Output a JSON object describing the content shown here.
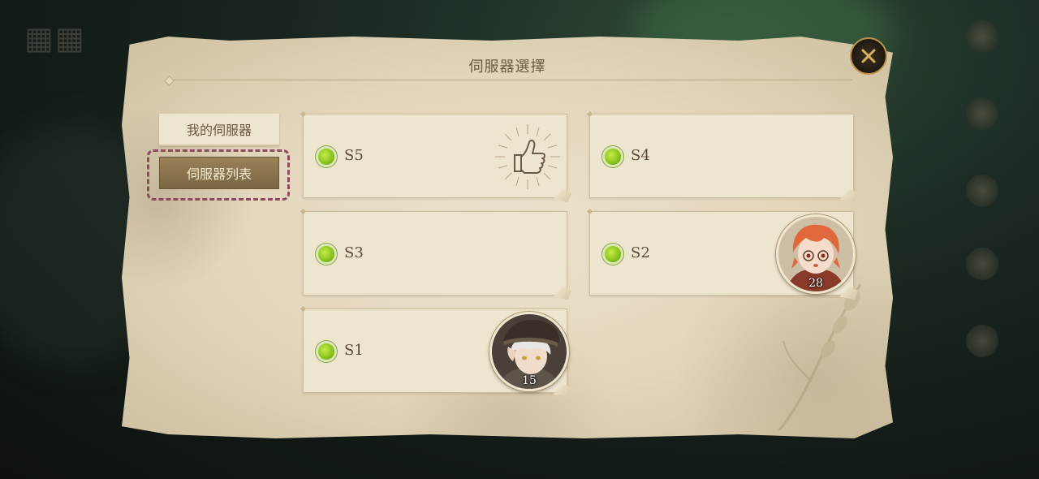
{
  "dialog": {
    "title": "伺服器選擇"
  },
  "tabs": [
    {
      "label": "我的伺服器",
      "active": false
    },
    {
      "label": "伺服器列表",
      "active": true
    }
  ],
  "servers": [
    {
      "name": "S5",
      "status": "online",
      "badge": "thumbs-up-icon"
    },
    {
      "name": "S4",
      "status": "online"
    },
    {
      "name": "S3",
      "status": "online"
    },
    {
      "name": "S2",
      "status": "online",
      "character_level": "28"
    },
    {
      "name": "S1",
      "status": "online",
      "character_level": "15"
    }
  ],
  "colors": {
    "online": "#8cc63f",
    "highlight_border": "#8e4a5e",
    "active_tab": "#8a7250"
  }
}
